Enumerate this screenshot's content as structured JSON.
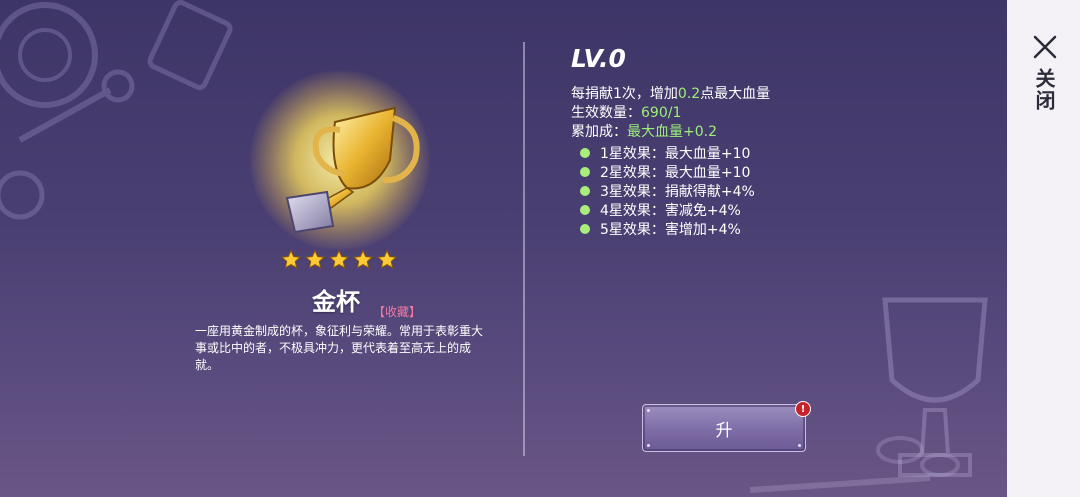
{
  "close": {
    "label": "关闭",
    "icon": "close-icon"
  },
  "item": {
    "name": "金杯",
    "tag": "【收藏】",
    "stars": 5,
    "description": "一座用黄金制成的杯，象征利与荣耀。常用于表彰重大事或比中的者，不极具冲力，更代表着至高无上的成就。"
  },
  "info": {
    "level": "LV.0",
    "donate": {
      "prefix": "每捐献1次，增加",
      "value": "0.2",
      "suffix": "点最大血量"
    },
    "count": {
      "label": "生效数量：",
      "value": "690/1"
    },
    "bonus": {
      "label": "累加成：",
      "value": "最大血量+0.2"
    },
    "effects": [
      {
        "label": "1星效果：最大血量+10"
      },
      {
        "label": "2星效果：最大血量+10"
      },
      {
        "label": "3星效果：捐献得献+4%"
      },
      {
        "label": "4星效果：害减免+4%"
      },
      {
        "label": "5星效果：害增加+4%"
      }
    ]
  },
  "upgrade": {
    "label": "升",
    "badge": "!"
  },
  "colors": {
    "accent_green": "#9df07a",
    "tag_pink": "#f07aa5",
    "badge_red": "#c8232a"
  }
}
